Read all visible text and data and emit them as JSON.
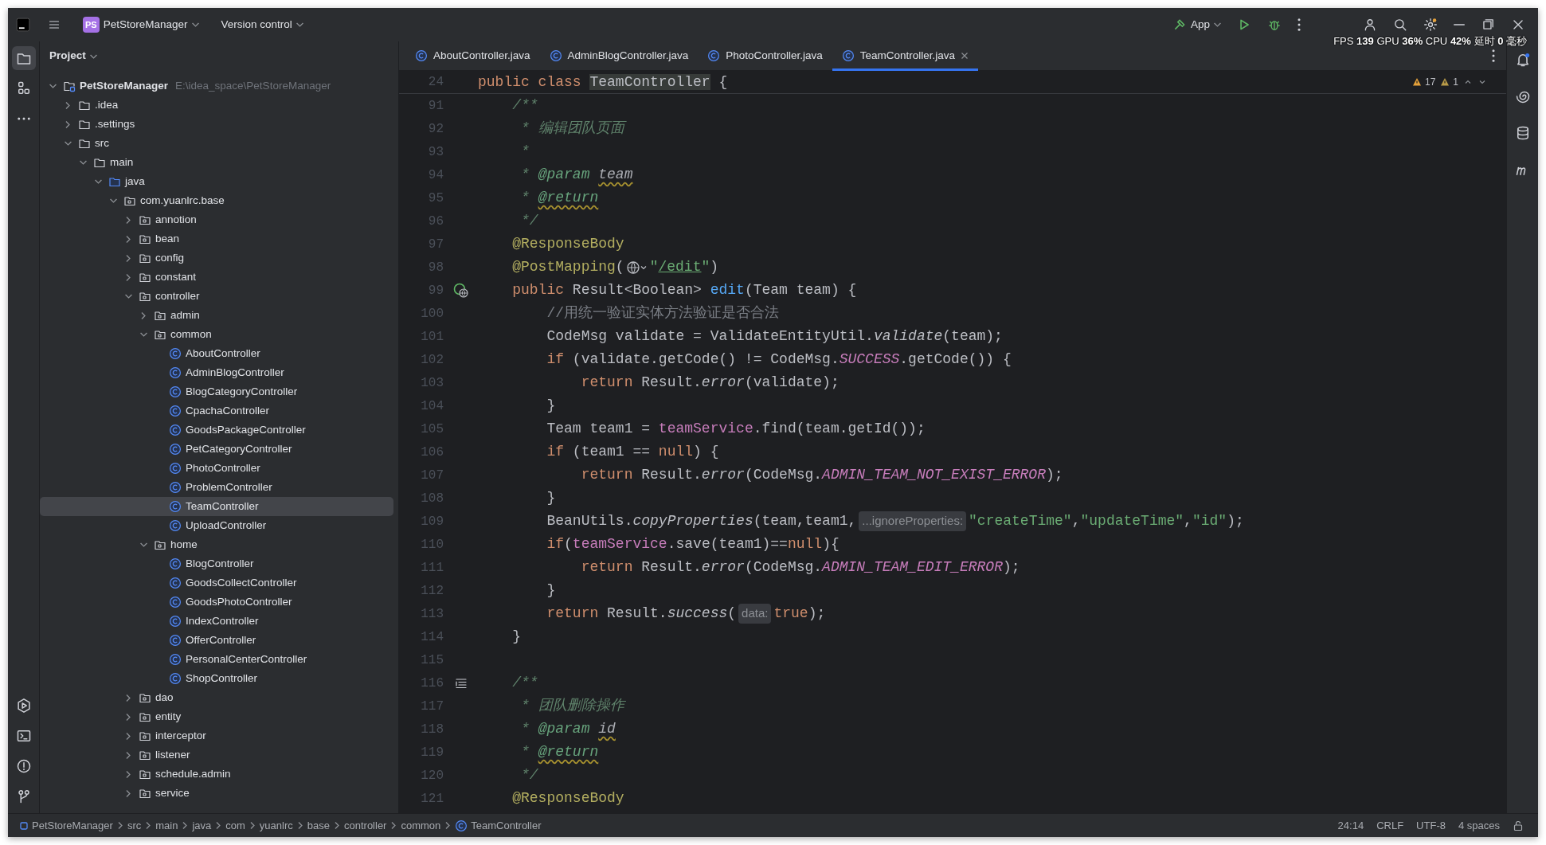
{
  "title_bar": {
    "project_badge": "PS",
    "project": "PetStoreManager",
    "vcs": "Version control",
    "run_config": "App"
  },
  "overlay": {
    "text": "FPS **139** GPU **36%** CPU **42%** 延时 **0** 毫秒"
  },
  "left_toolbar": {
    "top": [
      {
        "selected": true
      },
      {
        "selected": false
      },
      {
        "selected": false
      }
    ],
    "bottom": [
      {
        "selected": false
      },
      {
        "selected": false
      },
      {
        "selected": false
      },
      {
        "selected": false
      }
    ]
  },
  "tool_window": {
    "title": "Project"
  },
  "tabs": [
    {
      "label": "AboutController.java",
      "selected": false
    },
    {
      "label": "AdminBlogController.java",
      "selected": false
    },
    {
      "label": "PhotoController.java",
      "selected": false
    },
    {
      "label": "TeamController.java",
      "selected": true
    }
  ],
  "tree": [
    {
      "label": "PetStoreManager",
      "kind": "project",
      "path": "E:\\idea_space\\PetStoreManager",
      "expanded": true,
      "selected": false,
      "children": [
        {
          "label": ".idea",
          "kind": "folder",
          "expanded": false,
          "selected": false
        },
        {
          "label": ".settings",
          "kind": "folder",
          "expanded": false,
          "selected": false
        },
        {
          "label": "src",
          "kind": "folder",
          "expanded": true,
          "selected": false,
          "children": [
            {
              "label": "main",
              "kind": "folder",
              "expanded": true,
              "selected": false,
              "children": [
                {
                  "label": "java",
                  "kind": "source-root",
                  "expanded": true,
                  "selected": false,
                  "children": [
                    {
                      "label": "com.yuanlrc.base",
                      "kind": "package",
                      "expanded": true,
                      "selected": false,
                      "children": [
                        {
                          "label": "annotion",
                          "kind": "package",
                          "expanded": false,
                          "selected": false
                        },
                        {
                          "label": "bean",
                          "kind": "package",
                          "expanded": false,
                          "selected": false
                        },
                        {
                          "label": "config",
                          "kind": "package",
                          "expanded": false,
                          "selected": false
                        },
                        {
                          "label": "constant",
                          "kind": "package",
                          "expanded": false,
                          "selected": false
                        },
                        {
                          "label": "controller",
                          "kind": "package",
                          "expanded": true,
                          "selected": false,
                          "children": [
                            {
                              "label": "admin",
                              "kind": "package",
                              "expanded": false,
                              "selected": false
                            },
                            {
                              "label": "common",
                              "kind": "package",
                              "expanded": true,
                              "selected": false,
                              "children": [
                                {
                                  "label": "AboutController",
                                  "kind": "class",
                                  "selected": false
                                },
                                {
                                  "label": "AdminBlogController",
                                  "kind": "class",
                                  "selected": false
                                },
                                {
                                  "label": "BlogCategoryController",
                                  "kind": "class",
                                  "selected": false
                                },
                                {
                                  "label": "CpachaController",
                                  "kind": "class",
                                  "selected": false
                                },
                                {
                                  "label": "GoodsPackageController",
                                  "kind": "class",
                                  "selected": false
                                },
                                {
                                  "label": "PetCategoryController",
                                  "kind": "class",
                                  "selected": false
                                },
                                {
                                  "label": "PhotoController",
                                  "kind": "class",
                                  "selected": false
                                },
                                {
                                  "label": "ProblemController",
                                  "kind": "class",
                                  "selected": false
                                },
                                {
                                  "label": "TeamController",
                                  "kind": "class",
                                  "selected": true
                                },
                                {
                                  "label": "UploadController",
                                  "kind": "class",
                                  "selected": false
                                }
                              ]
                            },
                            {
                              "label": "home",
                              "kind": "package",
                              "expanded": true,
                              "selected": false,
                              "children": [
                                {
                                  "label": "BlogController",
                                  "kind": "class",
                                  "selected": false
                                },
                                {
                                  "label": "GoodsCollectController",
                                  "kind": "class",
                                  "selected": false
                                },
                                {
                                  "label": "GoodsPhotoController",
                                  "kind": "class",
                                  "selected": false
                                },
                                {
                                  "label": "IndexController",
                                  "kind": "class",
                                  "selected": false
                                },
                                {
                                  "label": "OfferController",
                                  "kind": "class",
                                  "selected": false
                                },
                                {
                                  "label": "PersonalCenterController",
                                  "kind": "class",
                                  "selected": false
                                },
                                {
                                  "label": "ShopController",
                                  "kind": "class",
                                  "selected": false
                                }
                              ]
                            }
                          ]
                        },
                        {
                          "label": "dao",
                          "kind": "package",
                          "expanded": false,
                          "selected": false
                        },
                        {
                          "label": "entity",
                          "kind": "package",
                          "expanded": false,
                          "selected": false
                        },
                        {
                          "label": "interceptor",
                          "kind": "package",
                          "expanded": false,
                          "selected": false
                        },
                        {
                          "label": "listener",
                          "kind": "package",
                          "expanded": false,
                          "selected": false
                        },
                        {
                          "label": "schedule.admin",
                          "kind": "package",
                          "expanded": false,
                          "selected": false
                        },
                        {
                          "label": "service",
                          "kind": "package",
                          "expanded": false,
                          "selected": false
                        }
                      ]
                    }
                  ]
                }
              ]
            }
          ]
        }
      ]
    }
  ],
  "editor": {
    "sticky": {
      "number": "24",
      "tokens": [
        {
          "kind": "keyword",
          "text": "public class "
        },
        {
          "kind": "usage",
          "text": "TeamController"
        },
        {
          "kind": "plain",
          "text": " {"
        }
      ]
    },
    "inspections": {
      "warnings": "17",
      "weak_warnings": "1"
    },
    "lines": [
      {
        "number": "91",
        "kind": "plain",
        "tokens": [
          {
            "kind": "doc",
            "text": "    /**"
          }
        ]
      },
      {
        "number": "92",
        "kind": "plain",
        "tokens": [
          {
            "kind": "doc",
            "text": "     * 编辑团队页面"
          }
        ]
      },
      {
        "number": "93",
        "kind": "plain",
        "tokens": [
          {
            "kind": "doc",
            "text": "     *"
          }
        ]
      },
      {
        "number": "94",
        "kind": "plain",
        "tokens": [
          {
            "kind": "doc",
            "text": "     * "
          },
          {
            "kind": "tag",
            "text": "@param "
          },
          {
            "kind": "refwarn",
            "text": "team"
          }
        ]
      },
      {
        "number": "95",
        "kind": "plain",
        "tokens": [
          {
            "kind": "doc",
            "text": "     * "
          },
          {
            "kind": "tagwarn",
            "text": "@return"
          }
        ]
      },
      {
        "number": "96",
        "kind": "plain",
        "tokens": [
          {
            "kind": "doc",
            "text": "     */"
          }
        ]
      },
      {
        "number": "97",
        "kind": "plain",
        "tokens": [
          {
            "kind": "annotation",
            "text": "    @ResponseBody"
          }
        ]
      },
      {
        "number": "98",
        "kind": "plain",
        "tokens": [
          {
            "kind": "annotation",
            "text": "    @PostMapping"
          },
          {
            "kind": "plain",
            "text": "("
          },
          {
            "kind": "globe"
          },
          {
            "kind": "string",
            "text": "\""
          },
          {
            "kind": "link",
            "text": "/edit"
          },
          {
            "kind": "string",
            "text": "\""
          },
          {
            "kind": "plain",
            "text": ")"
          }
        ]
      },
      {
        "number": "99",
        "kind": "endpoint",
        "tokens": [
          {
            "kind": "keyword",
            "text": "    public"
          },
          {
            "kind": "plain",
            "text": " Result<Boolean> "
          },
          {
            "kind": "declaration",
            "text": "edit"
          },
          {
            "kind": "plain",
            "text": "(Team team) {"
          }
        ]
      },
      {
        "number": "100",
        "kind": "plain",
        "tokens": [
          {
            "kind": "comment",
            "text": "        //用统一验证实体方法验证是否合法"
          }
        ]
      },
      {
        "number": "101",
        "kind": "plain",
        "tokens": [
          {
            "kind": "plain",
            "text": "        CodeMsg validate = ValidateEntityUtil."
          },
          {
            "kind": "italic",
            "text": "validate"
          },
          {
            "kind": "plain",
            "text": "(team);"
          }
        ]
      },
      {
        "number": "102",
        "kind": "plain",
        "tokens": [
          {
            "kind": "keyword",
            "text": "        if"
          },
          {
            "kind": "plain",
            "text": " (validate.getCode() != CodeMsg."
          },
          {
            "kind": "constant",
            "text": "SUCCESS"
          },
          {
            "kind": "plain",
            "text": ".getCode()) {"
          }
        ]
      },
      {
        "number": "103",
        "kind": "plain",
        "tokens": [
          {
            "kind": "keyword",
            "text": "            return"
          },
          {
            "kind": "plain",
            "text": " Result."
          },
          {
            "kind": "italic",
            "text": "error"
          },
          {
            "kind": "plain",
            "text": "(validate);"
          }
        ]
      },
      {
        "number": "104",
        "kind": "plain",
        "tokens": [
          {
            "kind": "plain",
            "text": "        }"
          }
        ]
      },
      {
        "number": "105",
        "kind": "plain",
        "tokens": [
          {
            "kind": "plain",
            "text": "        Team team1 = "
          },
          {
            "kind": "field",
            "text": "teamService"
          },
          {
            "kind": "plain",
            "text": ".find(team.getId());"
          }
        ]
      },
      {
        "number": "106",
        "kind": "plain",
        "tokens": [
          {
            "kind": "keyword",
            "text": "        if"
          },
          {
            "kind": "plain",
            "text": " (team1 == "
          },
          {
            "kind": "keyword",
            "text": "null"
          },
          {
            "kind": "plain",
            "text": ") {"
          }
        ]
      },
      {
        "number": "107",
        "kind": "plain",
        "tokens": [
          {
            "kind": "keyword",
            "text": "            return"
          },
          {
            "kind": "plain",
            "text": " Result."
          },
          {
            "kind": "italic",
            "text": "error"
          },
          {
            "kind": "plain",
            "text": "(CodeMsg."
          },
          {
            "kind": "constant",
            "text": "ADMIN_TEAM_NOT_EXIST_ERROR"
          },
          {
            "kind": "plain",
            "text": ");"
          }
        ]
      },
      {
        "number": "108",
        "kind": "plain",
        "tokens": [
          {
            "kind": "plain",
            "text": "        }"
          }
        ]
      },
      {
        "number": "109",
        "kind": "plain",
        "tokens": [
          {
            "kind": "plain",
            "text": "        BeanUtils."
          },
          {
            "kind": "italic",
            "text": "copyProperties"
          },
          {
            "kind": "plain",
            "text": "(team,team1,"
          },
          {
            "kind": "hint",
            "text": "...ignoreProperties:"
          },
          {
            "kind": "string",
            "text": "\"createTime\""
          },
          {
            "kind": "plain",
            "text": ","
          },
          {
            "kind": "string",
            "text": "\"updateTime\""
          },
          {
            "kind": "plain",
            "text": ","
          },
          {
            "kind": "string",
            "text": "\"id\""
          },
          {
            "kind": "plain",
            "text": ");"
          }
        ]
      },
      {
        "number": "110",
        "kind": "plain",
        "tokens": [
          {
            "kind": "keyword",
            "text": "        if"
          },
          {
            "kind": "plain",
            "text": "("
          },
          {
            "kind": "field",
            "text": "teamService"
          },
          {
            "kind": "plain",
            "text": ".save(team1)=="
          },
          {
            "kind": "keyword",
            "text": "null"
          },
          {
            "kind": "plain",
            "text": "){"
          }
        ]
      },
      {
        "number": "111",
        "kind": "plain",
        "tokens": [
          {
            "kind": "keyword",
            "text": "            return"
          },
          {
            "kind": "plain",
            "text": " Result."
          },
          {
            "kind": "italic",
            "text": "error"
          },
          {
            "kind": "plain",
            "text": "(CodeMsg."
          },
          {
            "kind": "constant",
            "text": "ADMIN_TEAM_EDIT_ERROR"
          },
          {
            "kind": "plain",
            "text": ");"
          }
        ]
      },
      {
        "number": "112",
        "kind": "plain",
        "tokens": [
          {
            "kind": "plain",
            "text": "        }"
          }
        ]
      },
      {
        "number": "113",
        "kind": "plain",
        "tokens": [
          {
            "kind": "keyword",
            "text": "        return"
          },
          {
            "kind": "plain",
            "text": " Result."
          },
          {
            "kind": "italic",
            "text": "success"
          },
          {
            "kind": "plain",
            "text": "("
          },
          {
            "kind": "hint",
            "text": "data:"
          },
          {
            "kind": "keyword",
            "text": "true"
          },
          {
            "kind": "plain",
            "text": ");"
          }
        ]
      },
      {
        "number": "114",
        "kind": "plain",
        "tokens": [
          {
            "kind": "plain",
            "text": "    }"
          }
        ]
      },
      {
        "number": "115",
        "kind": "plain"
      },
      {
        "number": "116",
        "kind": "javadoc",
        "tokens": [
          {
            "kind": "doc",
            "text": "    /**"
          }
        ]
      },
      {
        "number": "117",
        "kind": "plain",
        "tokens": [
          {
            "kind": "doc",
            "text": "     * 团队删除操作"
          }
        ]
      },
      {
        "number": "118",
        "kind": "plain",
        "tokens": [
          {
            "kind": "doc",
            "text": "     * "
          },
          {
            "kind": "tag",
            "text": "@param "
          },
          {
            "kind": "refwarn",
            "text": "id"
          }
        ]
      },
      {
        "number": "119",
        "kind": "plain",
        "tokens": [
          {
            "kind": "doc",
            "text": "     * "
          },
          {
            "kind": "tagwarn",
            "text": "@return"
          }
        ]
      },
      {
        "number": "120",
        "kind": "plain",
        "tokens": [
          {
            "kind": "doc",
            "text": "     */"
          }
        ]
      },
      {
        "number": "121",
        "kind": "plain",
        "tokens": [
          {
            "kind": "annotation",
            "text": "    @ResponseBody"
          }
        ]
      }
    ]
  },
  "breadcrumbs": [
    {
      "label": "PetStoreManager",
      "kind": "module"
    },
    {
      "label": "src",
      "kind": "folder"
    },
    {
      "label": "main",
      "kind": "folder"
    },
    {
      "label": "java",
      "kind": "folder"
    },
    {
      "label": "com",
      "kind": "folder"
    },
    {
      "label": "yuanlrc",
      "kind": "folder"
    },
    {
      "label": "base",
      "kind": "folder"
    },
    {
      "label": "controller",
      "kind": "folder"
    },
    {
      "label": "common",
      "kind": "folder"
    },
    {
      "label": "TeamController",
      "kind": "class"
    }
  ],
  "status": {
    "position": "24:14",
    "line_ending": "CRLF",
    "encoding": "UTF-8",
    "indent": "4 spaces"
  }
}
